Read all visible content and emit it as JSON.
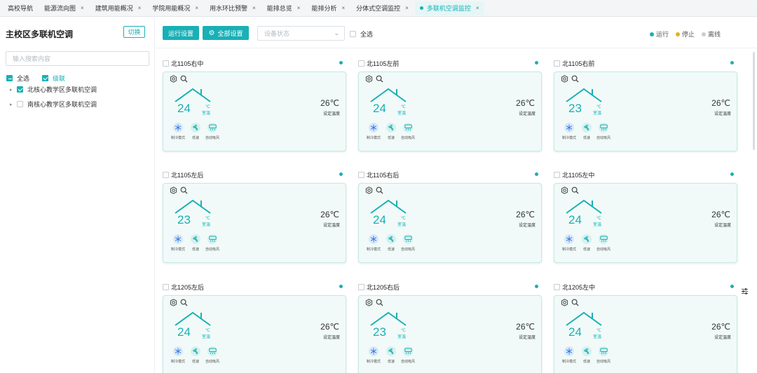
{
  "tabs": [
    {
      "label": "高校导航",
      "closable": false,
      "active": false
    },
    {
      "label": "能源流向图",
      "closable": true,
      "active": false
    },
    {
      "label": "建筑用能概况",
      "closable": true,
      "active": false
    },
    {
      "label": "学院用能概况",
      "closable": true,
      "active": false
    },
    {
      "label": "用水环比预警",
      "closable": true,
      "active": false
    },
    {
      "label": "能排总览",
      "closable": true,
      "active": false
    },
    {
      "label": "能排分析",
      "closable": true,
      "active": false
    },
    {
      "label": "分体式空调监控",
      "closable": true,
      "active": false
    },
    {
      "label": "多联机空调监控",
      "closable": true,
      "active": true
    }
  ],
  "close_glyph": "×",
  "sidebar": {
    "title": "主校区多联机空调",
    "switch_label": "切换",
    "search_placeholder": "输入搜索内容",
    "select_all_label": "全选",
    "cascade_label": "级联",
    "tree": [
      {
        "label": "北核心教学区多联机空调",
        "checked": true
      },
      {
        "label": "南核心教学区多联机空调",
        "checked": false
      }
    ]
  },
  "toolbar": {
    "run_settings": "运行设置",
    "all_settings": "全部设置",
    "status_placeholder": "设备状态",
    "select_all": "全选",
    "legend": [
      {
        "label": "运行",
        "color": "#19b0b6"
      },
      {
        "label": "停止",
        "color": "#e2b21a"
      },
      {
        "label": "离线",
        "color": "#c9ccd0"
      }
    ]
  },
  "card_labels": {
    "cur_unit": "℃",
    "cur_label": "室温",
    "set_label": "设定温度",
    "modes": [
      "制冷模式",
      "低速",
      "自动吸风"
    ]
  },
  "devices": [
    {
      "name": "北1105右中",
      "current": "24",
      "set_temp": "26℃",
      "status": "运行"
    },
    {
      "name": "北1105左前",
      "current": "24",
      "set_temp": "26℃",
      "status": "运行"
    },
    {
      "name": "北1105右前",
      "current": "23",
      "set_temp": "26℃",
      "status": "运行"
    },
    {
      "name": "北1105左后",
      "current": "23",
      "set_temp": "26℃",
      "status": "运行"
    },
    {
      "name": "北1105右后",
      "current": "24",
      "set_temp": "26℃",
      "status": "运行"
    },
    {
      "name": "北1105左中",
      "current": "24",
      "set_temp": "26℃",
      "status": "运行"
    },
    {
      "name": "北1205左后",
      "current": "24",
      "set_temp": "26℃",
      "status": "运行"
    },
    {
      "name": "北1205右后",
      "current": "23",
      "set_temp": "26℃",
      "status": "运行"
    },
    {
      "name": "北1205左中",
      "current": "24",
      "set_temp": "26℃",
      "status": "运行"
    }
  ]
}
